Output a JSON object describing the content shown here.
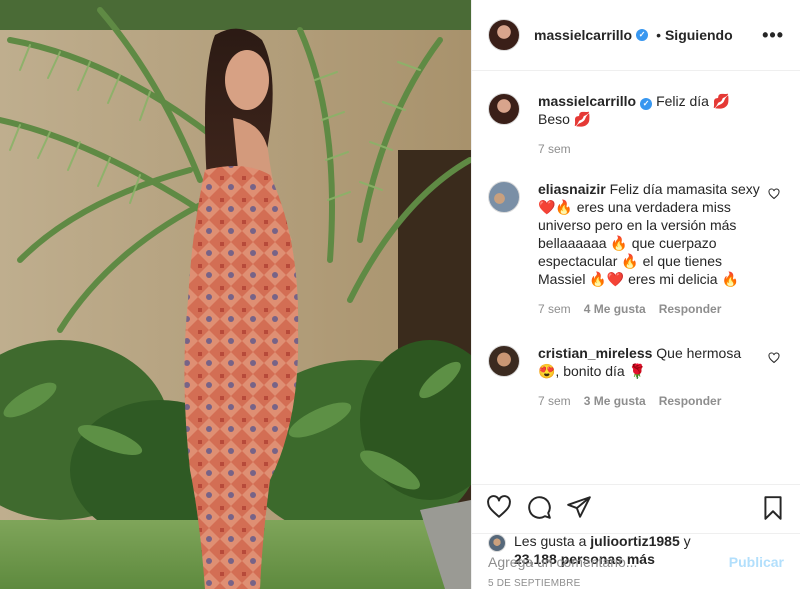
{
  "colors": {
    "link_blue": "#0095f6",
    "publish_disabled": "#b2dffc",
    "muted": "#8e8e8e",
    "verified": "#3897f0"
  },
  "header": {
    "username": "massielcarrillo",
    "separator": "•",
    "follow_status": "Siguiendo",
    "more_icon": "more-horizontal-icon",
    "more_label": "•••"
  },
  "caption": {
    "username": "massielcarrillo",
    "text": "Feliz día 💋 Beso 💋",
    "time": "7 sem"
  },
  "comments": [
    {
      "username": "eliasnaizir",
      "text": "Feliz día mamasita sexy ❤️🔥 eres una verdadera miss universo pero en la versión más bellaaaaaa 🔥 que cuerpazo espectacular 🔥 el que tienes Massiel 🔥❤️ eres mi delicia 🔥",
      "time": "7 sem",
      "likes": "4 Me gusta",
      "reply": "Responder"
    },
    {
      "username": "cristian_mireless",
      "text": "Que hermosa 😍, bonito día 🌹",
      "time": "7 sem",
      "likes": "3 Me gusta",
      "reply": "Responder"
    }
  ],
  "actions": {
    "icons": [
      "heart-icon",
      "comment-icon",
      "share-icon",
      "bookmark-icon"
    ]
  },
  "likes": {
    "prefix": "Les gusta a",
    "user": "julioortiz1985",
    "connector": "y",
    "others": "23,188 personas más"
  },
  "date": "5 DE SEPTIEMBRE",
  "add_comment": {
    "placeholder": "Agrega un comentario...",
    "publish": "Publicar"
  }
}
